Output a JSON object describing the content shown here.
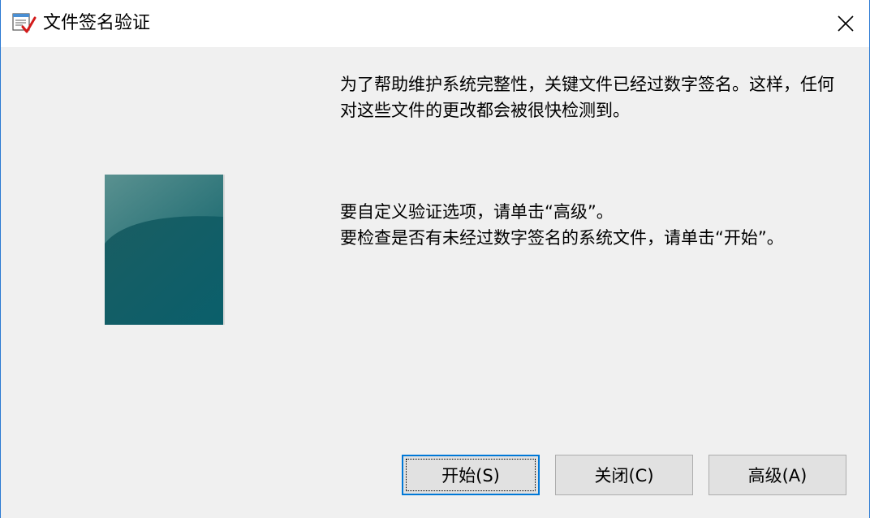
{
  "window": {
    "title": "文件签名验证"
  },
  "content": {
    "paragraph1": "为了帮助维护系统完整性，关键文件已经过数字签名。这样，任何对这些文件的更改都会被很快检测到。",
    "paragraph2_line1": "要自定义验证选项，请单击“高级”。",
    "paragraph2_line2": "要检查是否有未经过数字签名的系统文件，请单击“开始”。"
  },
  "buttons": {
    "start": "开始(S)",
    "close": "关闭(C)",
    "advanced": "高级(A)"
  },
  "icons": {
    "app": "signature-verify-icon",
    "close": "close-icon"
  },
  "colors": {
    "accent": "#0078d7",
    "graphic_top": "#4f8a89",
    "graphic_bottom": "#0b5f68"
  }
}
